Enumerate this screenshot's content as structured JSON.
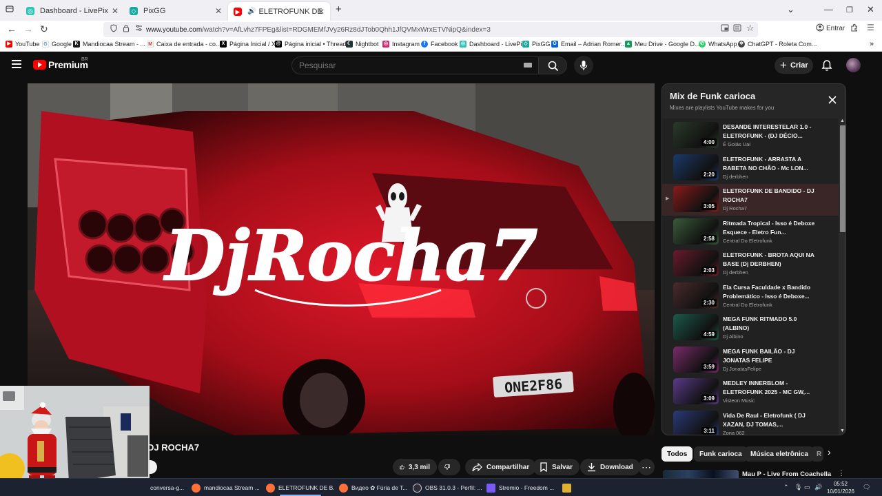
{
  "browser": {
    "tabs": [
      {
        "label": "Dashboard - LivePix",
        "active": false
      },
      {
        "label": "PixGG",
        "active": false
      },
      {
        "label": "ELETROFUNK DE BANDIDO",
        "active": true
      }
    ],
    "url_prefix": "www.youtube.com",
    "url_rest": "/watch?v=AfLvhz7FPEg&list=RDGMEMfJVy26Rz8dJTob0Qhh1JfQVMxWrxETVNipQ&index=3",
    "signin_label": "Entrar",
    "bookmarks": [
      "YouTube",
      "Google",
      "Mandiocaa Stream - ...",
      "Caixa de entrada - co...",
      "Página Inicial / X",
      "Página inicial • Threads",
      "Nightbot",
      "Instagram",
      "Facebook",
      "Dashboard - LivePix",
      "PixGG",
      "Email – Adrian Romer...",
      "Meu Drive - Google D...",
      "WhatsApp",
      "ChatGPT - Roleta Com..."
    ]
  },
  "youtube": {
    "brand": "Premium",
    "region": "BR",
    "search_placeholder": "Pesquisar",
    "create_label": "Criar"
  },
  "video": {
    "title_visible": "DJ ROCHA7",
    "likes": "3,3 mil",
    "share_label": "Compartilhar",
    "save_label": "Salvar",
    "download_label": "Download",
    "artwork_text": "DjRocha7",
    "plate_text": "ONE2F86"
  },
  "playlist": {
    "title": "Mix de Funk carioca",
    "subtitle": "Mixes are playlists YouTube makes for you",
    "items": [
      {
        "title": "DESANDE INTERESTELAR 1.0 - ELETROFUNK - (DJ DÉCIO...",
        "channel": "É Goiás Uai",
        "duration": "4:00",
        "thumb": "#2a3a2a"
      },
      {
        "title": "ELETROFUNK - ARRASTA A RABETA NO CHÃO - Mc LON...",
        "channel": "Dj derbhen",
        "duration": "2:20",
        "thumb": "#1a3a6a"
      },
      {
        "title": "ELETROFUNK DE BANDIDO - DJ ROCHA7",
        "channel": "Dj Rocha7",
        "duration": "3:05",
        "thumb": "#8a1a1a",
        "current": true
      },
      {
        "title": "Ritmada Tropical - Isso é Deboxe Esquece - Eletro Fun...",
        "channel": "Central Do Eletrofunk",
        "duration": "2:58",
        "thumb": "#3a5a3a"
      },
      {
        "title": "ELETROFUNK - BROTA AQUI NA BASE (Dj DERBHEN)",
        "channel": "Dj derbhen",
        "duration": "2:03",
        "thumb": "#6a1a2a"
      },
      {
        "title": "Ela Cursa Faculdade x Bandido Problemático - Isso é Deboxe...",
        "channel": "Central Do Eletrofunk",
        "duration": "2:30",
        "thumb": "#4a2a2a"
      },
      {
        "title": "MEGA FUNK RITMADO 5.0 (ALBINO)",
        "channel": "Dj Albino",
        "duration": "4:59",
        "thumb": "#1a5a4a"
      },
      {
        "title": "MEGA FUNK BAILÃO - DJ JONATAS FELIPE",
        "channel": "Dj JonatasFelipe",
        "duration": "3:59",
        "thumb": "#7a2a6a"
      },
      {
        "title": "MEDLEY INNERBLOM - ELETROFUNK 2025 - MC GW,...",
        "channel": "Visteon Music",
        "duration": "3:09",
        "thumb": "#5a3a8a"
      },
      {
        "title": "Vida De Raul - Eletrofunk ( DJ XAZAN, DJ TOMAS,...",
        "channel": "Zona 062",
        "duration": "3:11",
        "thumb": "#2a3a7a"
      }
    ]
  },
  "chips": [
    "Todos",
    "Funk carioca",
    "Música eletrônica",
    "R"
  ],
  "next_video_title": "Mau P - Live From Coachella",
  "taskbar": {
    "items": [
      {
        "label": "conversa-g...",
        "color": "#888888"
      },
      {
        "label": "mandiocaa Stream ...",
        "color": "#ff7139"
      },
      {
        "label": "ELETROFUNK DE B...",
        "color": "#ff7139"
      },
      {
        "label": "Видео ✿ Fúria de T...",
        "color": "#ff7139"
      },
      {
        "label": "OBS 31.0.3 - Perfil: ...",
        "color": "#302e3a"
      },
      {
        "label": "Stremio - Freedom ...",
        "color": "#7b5bf5"
      }
    ],
    "time": "05:52",
    "date": "10/01/2026"
  }
}
